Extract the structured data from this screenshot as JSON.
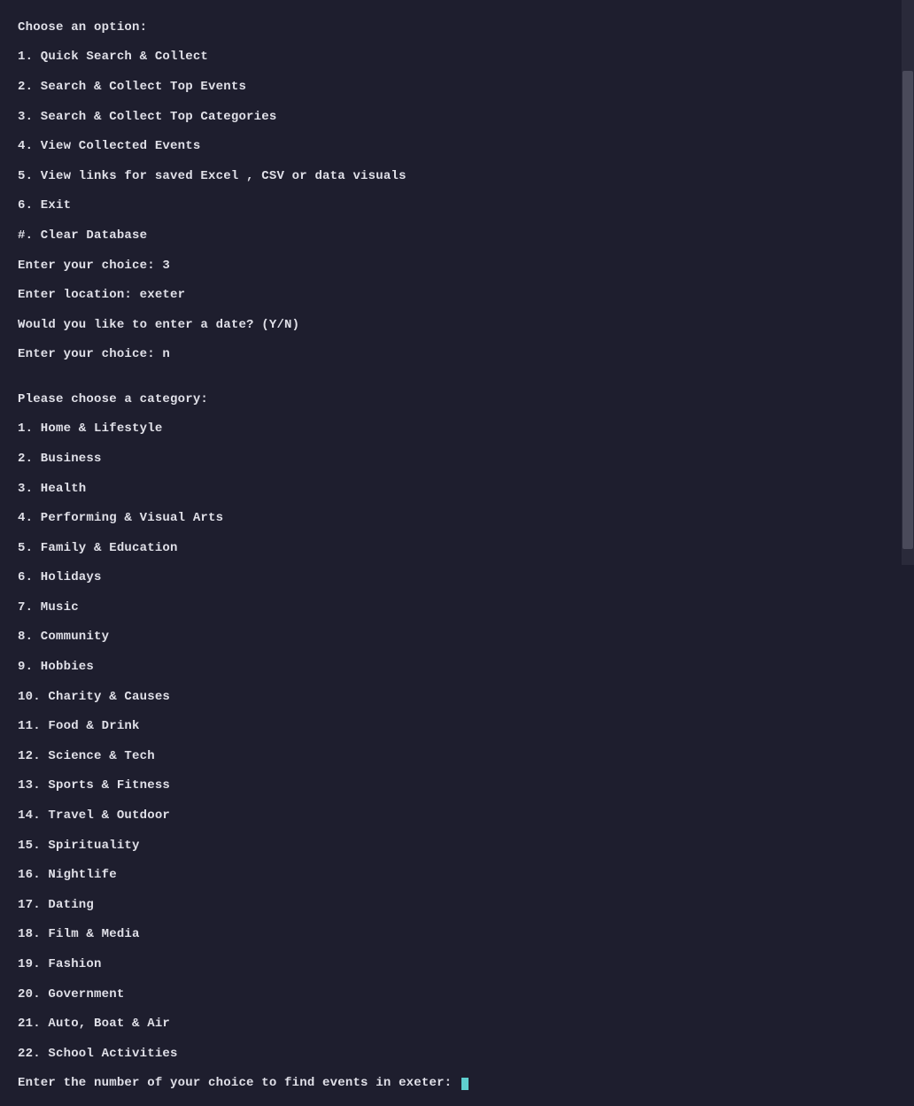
{
  "menu": {
    "header": "Choose an option:",
    "options": [
      "1. Quick Search & Collect",
      "2. Search & Collect Top Events",
      "3. Search & Collect Top Categories",
      "4. View Collected Events",
      "5. View links for saved Excel , CSV or data visuals",
      "6. Exit",
      "#. Clear Database"
    ],
    "choice_prompt": "Enter your choice: 3",
    "location_prompt": "Enter location: exeter",
    "date_prompt": "Would you like to enter a date? (Y/N)",
    "date_choice": "Enter your choice: n"
  },
  "blank": "",
  "categories": {
    "header": "Please choose a category:",
    "items": [
      "1. Home & Lifestyle",
      "2. Business",
      "3. Health",
      "4. Performing & Visual Arts",
      "5. Family & Education",
      "6. Holidays",
      "7. Music",
      "8. Community",
      "9. Hobbies",
      "10. Charity & Causes",
      "11. Food & Drink",
      "12. Science & Tech",
      "13. Sports & Fitness",
      "14. Travel & Outdoor",
      "15. Spirituality",
      "16. Nightlife",
      "17. Dating",
      "18. Film & Media",
      "19. Fashion",
      "20. Government",
      "21. Auto, Boat & Air",
      "22. School Activities"
    ],
    "final_prompt": "Enter the number of your choice to find events in exeter: "
  }
}
